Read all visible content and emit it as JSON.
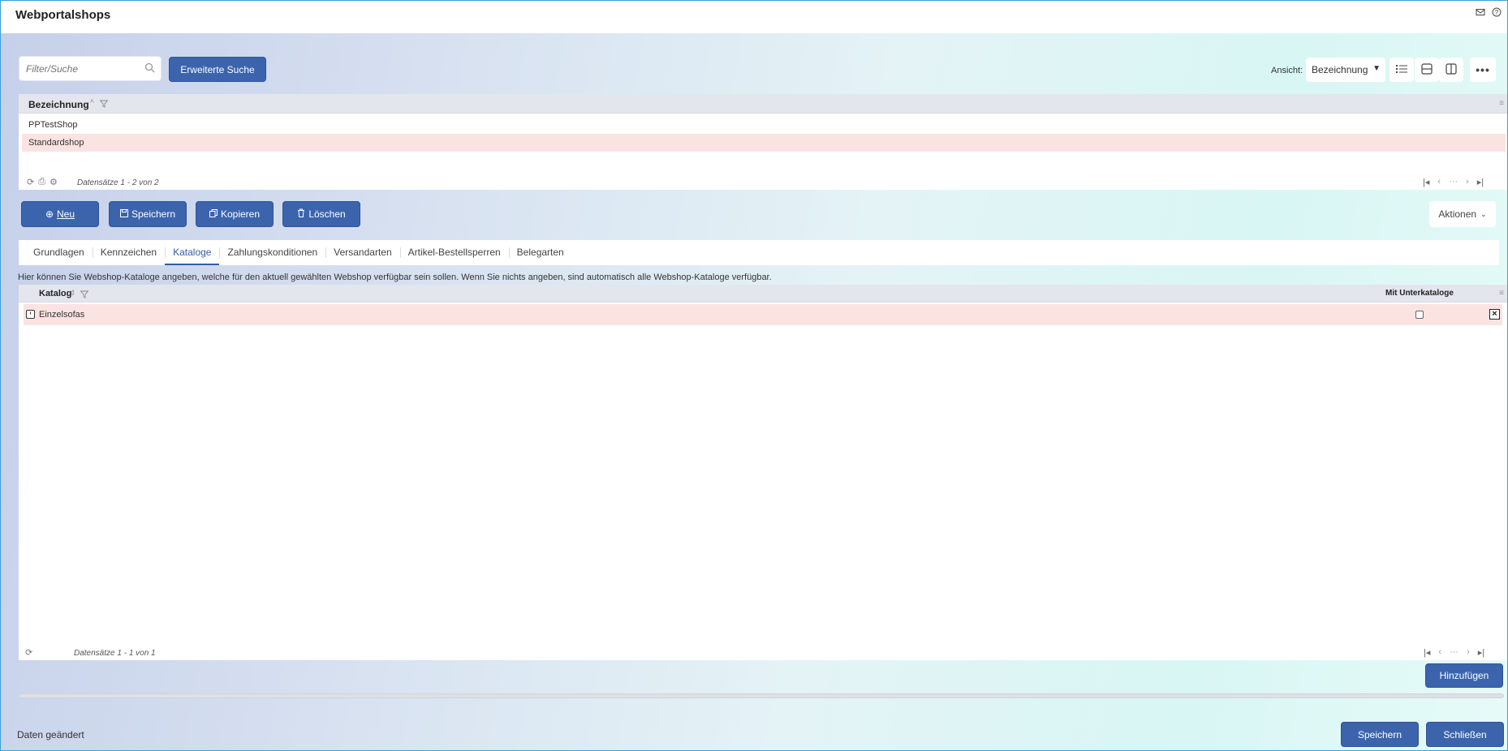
{
  "window": {
    "title": "Webportalshops",
    "icons": [
      "mail-icon",
      "help-icon"
    ]
  },
  "toolbar": {
    "search_placeholder": "Filter/Suche",
    "advanced_search_label": "Erweiterte Suche",
    "view_label": "Ansicht:",
    "view_value": "Bezeichnung"
  },
  "shops_grid": {
    "column": "Bezeichnung",
    "rows": [
      "PPTestShop",
      "Standardshop"
    ],
    "selected_index": 1,
    "footer_text": "Datensätze 1 - 2 von 2"
  },
  "actions": {
    "new": "Neu",
    "save": "Speichern",
    "copy": "Kopieren",
    "delete": "Löschen",
    "more": "Aktionen"
  },
  "tabs": [
    {
      "label": "Grundlagen",
      "active": false
    },
    {
      "label": "Kennzeichen",
      "active": false
    },
    {
      "label": "Kataloge",
      "active": true
    },
    {
      "label": "Zahlungskonditionen",
      "active": false
    },
    {
      "label": "Versandarten",
      "active": false
    },
    {
      "label": "Artikel-Bestellsperren",
      "active": false
    },
    {
      "label": "Belegarten",
      "active": false
    }
  ],
  "catalogs": {
    "hint": "Hier können Sie Webshop-Kataloge angeben, welche für den aktuell gewählten Webshop verfügbar sein sollen. Wenn Sie nichts angeben, sind automatisch alle Webshop-Kataloge verfügbar.",
    "col_catalog": "Katalog",
    "col_sub": "Mit Unterkataloge",
    "rows": [
      {
        "catalog": "Einzelsofas",
        "with_sub": false
      }
    ],
    "footer_text": "Datensätze 1 - 1 von 1",
    "add_label": "Hinzufügen"
  },
  "footer": {
    "status": "Daten geändert",
    "save": "Speichern",
    "close": "Schließen"
  },
  "colors": {
    "primary": "#3b64ad",
    "selected_row": "#fbe3e1",
    "active_tab": "#2f5ea8"
  }
}
